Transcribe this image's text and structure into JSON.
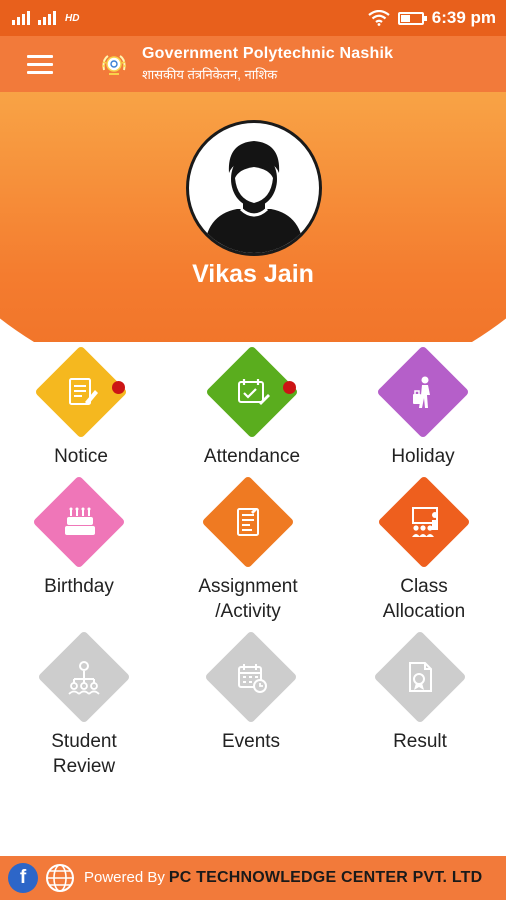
{
  "status_bar": {
    "network_label": "HD",
    "time": "6:39 pm",
    "battery_level": 0.45,
    "icons": [
      "signal-icon",
      "signal-icon",
      "wifi-icon",
      "battery-icon"
    ]
  },
  "app_bar": {
    "title": "Government Polytechnic Nashik",
    "subtitle": "शासकीय तंत्रनिकेतन, नाशिक",
    "menu_icon": "hamburger-menu-icon",
    "logo_icon": "institute-emblem-icon"
  },
  "profile": {
    "name": "Vikas Jain",
    "avatar_icon": "user-avatar-icon"
  },
  "colors": {
    "primary": "#f27a3a",
    "status_bar": "#e8601c",
    "notice": "#f5b81f",
    "attendance": "#5aad1e",
    "holiday": "#b55fc9",
    "birthday": "#ef76b8",
    "assignment": "#ef7a22",
    "class_allocation": "#ee5f1e",
    "disabled": "#cdcdcd",
    "notification_dot": "#cc1515"
  },
  "tiles": [
    {
      "label": "Notice",
      "icon": "notice-icon",
      "badge": true
    },
    {
      "label": "Attendance",
      "icon": "attendance-icon",
      "badge": true
    },
    {
      "label": "Holiday",
      "icon": "holiday-traveler-icon",
      "badge": false
    },
    {
      "label": "Birthday",
      "icon": "birthday-cake-icon",
      "badge": false
    },
    {
      "label": "Assignment\n/Activity",
      "icon": "assignment-icon",
      "badge": false
    },
    {
      "label": "Class\nAllocation",
      "icon": "classroom-icon",
      "badge": false
    },
    {
      "label": "Student\nReview",
      "icon": "student-review-icon",
      "badge": false
    },
    {
      "label": "Events",
      "icon": "events-calendar-icon",
      "badge": false
    },
    {
      "label": "Result",
      "icon": "result-certificate-icon",
      "badge": false
    }
  ],
  "footer": {
    "powered_by": "Powered By",
    "company": "PC TECHNOWLEDGE CENTER PVT. LTD",
    "facebook_letter": "f",
    "icons": [
      "facebook-icon",
      "website-globe-icon"
    ]
  }
}
